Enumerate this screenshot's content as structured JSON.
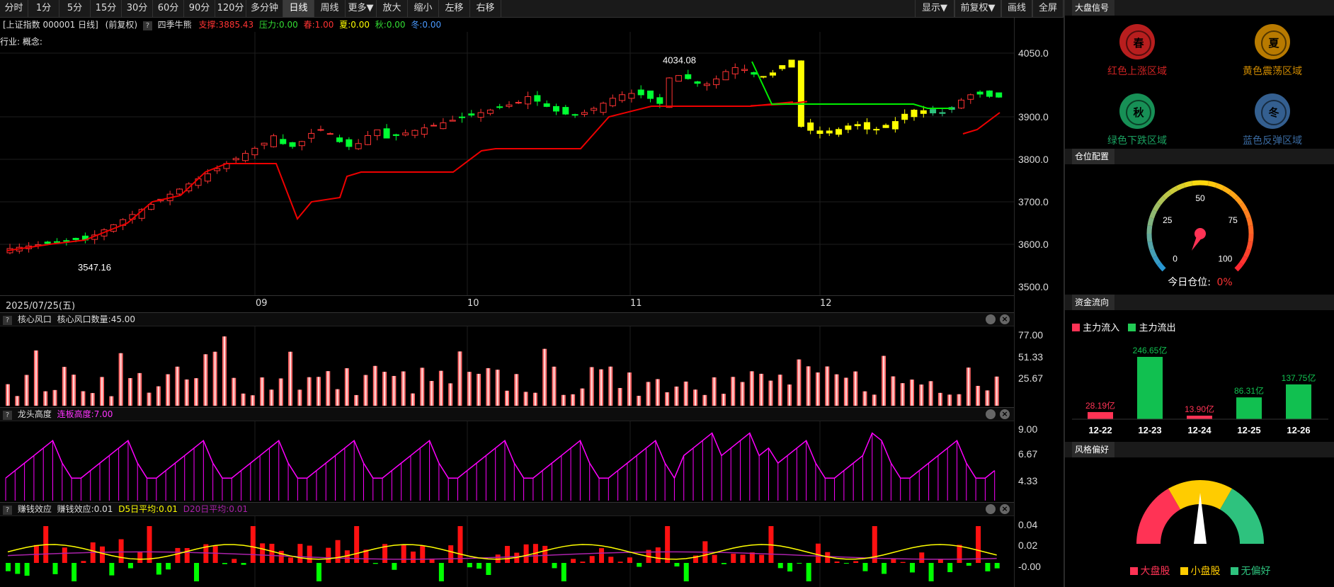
{
  "toolbar": {
    "left_buttons": [
      "分时",
      "1分",
      "5分",
      "15分",
      "30分",
      "60分",
      "90分",
      "120分",
      "多分钟",
      "日线",
      "周线",
      "更多▼",
      "放大",
      "缩小",
      "左移",
      "右移"
    ],
    "active": "日线",
    "right_buttons": [
      "显示▼",
      "前复权▼",
      "画线",
      "全屏"
    ]
  },
  "info": {
    "title": "[上证指数 000001 日线]",
    "adjust": "(前复权)",
    "indicator": "四季牛熊",
    "support": "支撑:3885.43",
    "pressure": "压力:0.00",
    "spring": "春:1.00",
    "summer": "夏:0.00",
    "autumn": "秋:0.00",
    "winter": "冬:0.00",
    "industry": "行业: 概念:"
  },
  "colors": {
    "up": "#ff3333",
    "down": "#00ff33",
    "yellow": "#ffff00",
    "magenta": "#ff00ff",
    "green_line": "#00ee00",
    "red_line": "#ee0000"
  },
  "price_chart": {
    "high_marker": "4034.08",
    "low_marker": "3547.16",
    "y_ticks": [
      "4050.0",
      "3900.0",
      "3800.0",
      "3700.0",
      "3600.0",
      "3500.0"
    ],
    "date_label": "2025/07/25(五)",
    "months": [
      "09",
      "10",
      "11",
      "12"
    ]
  },
  "panel_core": {
    "name": "核心风口",
    "field": "核心风口数量:45.00",
    "y_ticks": [
      "77.00",
      "51.33",
      "25.67"
    ]
  },
  "panel_dragon": {
    "name": "龙头高度",
    "field": "连板高度:7.00",
    "y_ticks": [
      "9.00",
      "6.67",
      "4.33"
    ]
  },
  "panel_profit": {
    "name": "赚钱效应",
    "field": "赚钱效应:0.01",
    "d5": "D5日平均:0.01",
    "d20": "D20日平均:0.01",
    "y_ticks": [
      "0.04",
      "0.02",
      "-0.00"
    ]
  },
  "signal": {
    "title": "大盘信号",
    "items": [
      {
        "char": "春",
        "label": "红色上涨区域",
        "color": "#cc2222"
      },
      {
        "char": "夏",
        "label": "黄色震荡区域",
        "color": "#cc8800"
      },
      {
        "char": "秋",
        "label": "绿色下跌区域",
        "color": "#1aa060"
      },
      {
        "char": "冬",
        "label": "蓝色反弹区域",
        "color": "#3a6aa0"
      }
    ]
  },
  "position": {
    "title": "仓位配置",
    "ticks": [
      "0",
      "25",
      "50",
      "75",
      "100"
    ],
    "label": "今日仓位:",
    "value": "0%"
  },
  "flow": {
    "title": "资金流向",
    "legend_in": "主力流入",
    "legend_out": "主力流出",
    "chart_data": {
      "type": "bar",
      "categories": [
        "12-22",
        "12-23",
        "12-24",
        "12-25",
        "12-26"
      ],
      "values": [
        28.19,
        246.65,
        13.9,
        86.31,
        137.75
      ],
      "labels": [
        "28.19亿",
        "246.65亿",
        "13.90亿",
        "86.31亿",
        "137.75亿"
      ],
      "directions": [
        "in",
        "out",
        "in",
        "out",
        "out"
      ]
    }
  },
  "style": {
    "title": "风格偏好",
    "legend": [
      "大盘股",
      "小盘股",
      "无偏好"
    ],
    "legend_colors": [
      "#ff3355",
      "#ffcc00",
      "#2ec27e"
    ]
  }
}
